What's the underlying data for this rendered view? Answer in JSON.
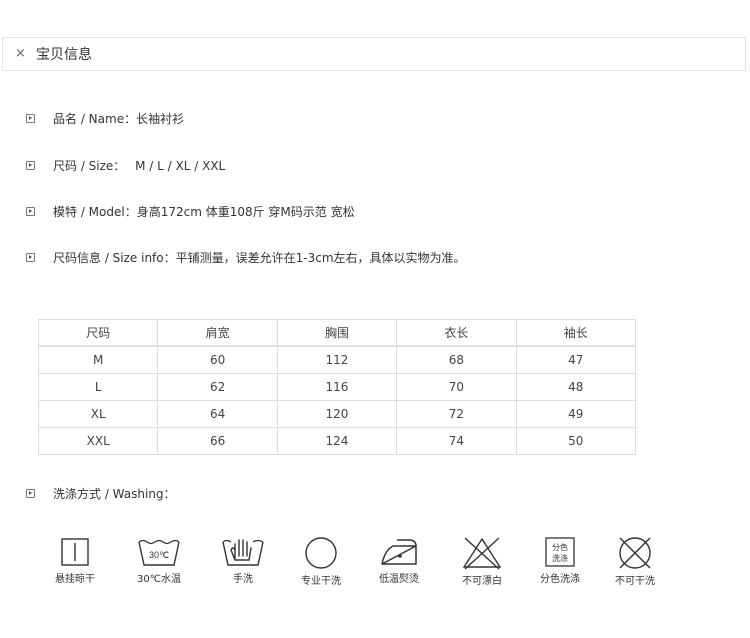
{
  "header": {
    "close_glyph": "×",
    "title": "宝贝信息"
  },
  "info": [
    {
      "label": "品名 / Name：",
      "value": "长袖衬衫"
    },
    {
      "label": "尺码 / Size：",
      "value": " M / L / XL / XXL"
    },
    {
      "label": "模特 / Model：",
      "value": "身高172cm  体重108斤  穿M码示范   宽松"
    },
    {
      "label": "尺码信息 / Size info：",
      "value": "平铺测量，误差允许在1-3cm左右，具体以实物为准。"
    }
  ],
  "size_table": {
    "headers": [
      "尺码",
      "肩宽",
      "胸围",
      "衣长",
      "袖长"
    ],
    "rows": [
      [
        "M",
        "60",
        "112",
        "68",
        "47"
      ],
      [
        "L",
        "62",
        "116",
        "70",
        "48"
      ],
      [
        "XL",
        "64",
        "120",
        "72",
        "49"
      ],
      [
        "XXL",
        "66",
        "124",
        "74",
        "50"
      ]
    ]
  },
  "washing": {
    "label": "洗涤方式 / Washing：",
    "icons": [
      {
        "icon": "hang-dry-icon",
        "label": "悬挂晾干"
      },
      {
        "icon": "wash-30-icon",
        "label": "30℃水温",
        "inner_text": "30℃"
      },
      {
        "icon": "hand-wash-icon",
        "label": "手洗"
      },
      {
        "icon": "dry-clean-icon",
        "label": "专业干洗"
      },
      {
        "icon": "low-iron-icon",
        "label": "低温熨烫"
      },
      {
        "icon": "no-bleach-icon",
        "label": "不可漂白"
      },
      {
        "icon": "separate-wash-icon",
        "label": "分色洗涤",
        "inner_text_1": "分色",
        "inner_text_2": "洗涤"
      },
      {
        "icon": "no-dry-clean-icon",
        "label": "不可干洗"
      }
    ]
  }
}
